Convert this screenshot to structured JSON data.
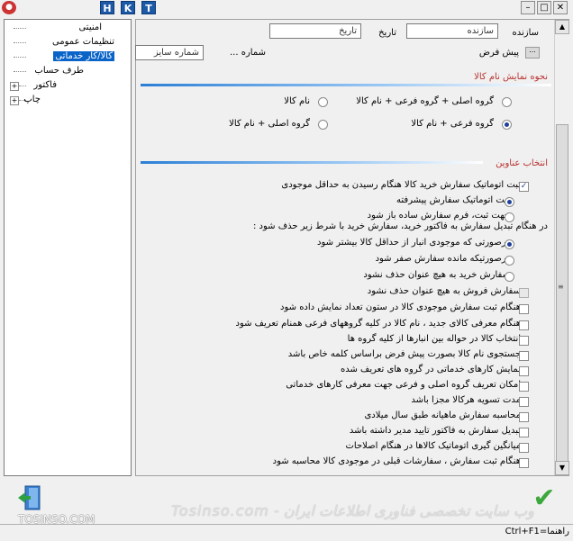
{
  "toolbar": {
    "hkt": [
      "H",
      "K",
      "T"
    ]
  },
  "tree": {
    "items": [
      {
        "label": "امنیتی",
        "selected": false
      },
      {
        "label": "تنظیمات عمومی",
        "selected": false
      },
      {
        "label": "کالا/کار خدماتی",
        "selected": true
      },
      {
        "label": "طرف حساب",
        "selected": false
      },
      {
        "label": "فاکتور",
        "selected": false,
        "expandable": true
      },
      {
        "label": "چاپ",
        "selected": false,
        "expandable": true
      }
    ]
  },
  "header_fields": {
    "creator_label": "سازنده",
    "creator_value": "سازنده",
    "date_label": "تاریخ",
    "date_value": "تاریخ",
    "default_label": "پیش فرض",
    "number_label": "شماره ...",
    "size_number_value": "شماره سایز"
  },
  "section_display": {
    "title": "نحوه نمایش نام کالا",
    "options": [
      {
        "label": "گروه اصلی + گروه فرعی + نام کالا",
        "selected": false
      },
      {
        "label": "نام کالا",
        "selected": false
      },
      {
        "label": "گروه فرعی + نام کالا",
        "selected": true
      },
      {
        "label": "گروه اصلی + نام کالا",
        "selected": false
      }
    ]
  },
  "section_titles": {
    "title": "انتخاب عناوین",
    "rows": [
      {
        "kind": "check",
        "checked": true,
        "label": "ثبت اتوماتیک سفارش خرید کالا هنگام رسیدن به حداقل موجودی"
      },
      {
        "kind": "radio",
        "checked": true,
        "label": "ثبت اتوماتیک سفارش پیشرفته"
      },
      {
        "kind": "radio",
        "checked": false,
        "label": "جهت ثبت، فرم سفارش ساده باز شود"
      },
      {
        "kind": "text",
        "label": "در هنگام تبدیل سفارش به فاکتور خرید، سفارش خرید با شرط زیر حذف شود :"
      },
      {
        "kind": "radio",
        "checked": true,
        "label": "درصورتی که موجودی انبار از حداقل کالا بیشتر شود"
      },
      {
        "kind": "radio",
        "checked": false,
        "label": "درصورتیکه مانده سفارش صفر شود"
      },
      {
        "kind": "radio",
        "checked": false,
        "label": "سفارش خرید به هیچ عنوان حذف نشود"
      },
      {
        "kind": "check-dis",
        "checked": false,
        "label": "سفارش فروش به هیچ عنوان حذف نشود"
      },
      {
        "kind": "check",
        "checked": false,
        "label": "هنگام ثبت سفارش موجودی کالا در ستون تعداد نمایش داده شود"
      },
      {
        "kind": "check",
        "checked": false,
        "label": "هنگام معرفی کالای جدید ، نام کالا در کلیه گروههای فرعی همنام تعریف شود"
      },
      {
        "kind": "check",
        "checked": false,
        "label": "انتخاب کالا در حواله بین انبارها از کلیه گروه ها"
      },
      {
        "kind": "check",
        "checked": false,
        "label": "جستجوی نام کالا بصورت پیش فرض براساس کلمه خاص باشد"
      },
      {
        "kind": "check",
        "checked": false,
        "label": "نمایش کارهای خدماتی در گروه های تعریف شده"
      },
      {
        "kind": "check",
        "checked": false,
        "label": "امکان تعریف گروه اصلی و فرعی جهت معرفی کارهای خدماتی"
      },
      {
        "kind": "check",
        "checked": false,
        "label": "مدت تسویه هرکالا مجزا باشد"
      },
      {
        "kind": "check",
        "checked": false,
        "label": "محاسبه سفارش ماهیانه طبق سال میلادی"
      },
      {
        "kind": "check",
        "checked": false,
        "label": "تبدیل سفارش به فاکتور تایید مدیر داشته باشد"
      },
      {
        "kind": "check",
        "checked": false,
        "label": "میانگین گیری اتوماتیک کالاها در هنگام اصلاحات"
      },
      {
        "kind": "check",
        "checked": false,
        "label": "هنگام ثبت سفارش ، سفارشات قبلی در موجودی کالا محاسبه شود"
      }
    ]
  },
  "watermark": "وب سایت تخصصی فناوری اطلاعات ایران - Tosinso.com",
  "logo_text": "TOSINSO.COM",
  "status": {
    "text": "راهنما=Ctrl+F1"
  },
  "colors": {
    "accent": "#0a64c8",
    "section_title": "#b8322f",
    "ok": "#3ca83c"
  }
}
